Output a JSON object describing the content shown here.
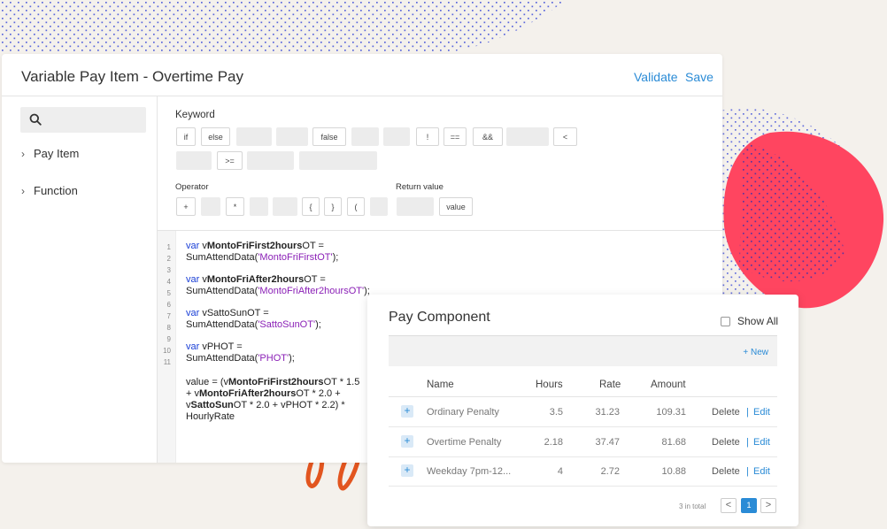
{
  "editor": {
    "title": "Variable Pay Item - Overtime Pay",
    "validate_label": "Validate",
    "save_label": "Save"
  },
  "sidebar": {
    "search_icon": "search-icon",
    "items": [
      {
        "label": "Pay Item",
        "icon": "chevron-right-icon"
      },
      {
        "label": "Function",
        "icon": "chevron-right-icon"
      }
    ]
  },
  "palette": {
    "keyword_label": "Keyword",
    "operator_label": "Operator",
    "return_value_label": "Return value",
    "keywords_row1": [
      "if",
      "else",
      "",
      "",
      "false",
      "",
      "",
      "!",
      "==",
      "&&",
      "",
      "<"
    ],
    "keywords_row2": [
      "",
      ">=",
      "",
      ""
    ],
    "operators": [
      "+",
      "",
      "*",
      "",
      "",
      "{",
      "}",
      "(",
      ""
    ],
    "return_values": [
      "",
      "value"
    ]
  },
  "code": {
    "line_numbers": [
      "1",
      "2",
      "3",
      "4",
      "5",
      "6",
      "7",
      "8",
      "9",
      "10",
      "11"
    ]
  },
  "pay_component": {
    "title": "Pay Component",
    "show_all_label": "Show All",
    "new_label": "+ New",
    "columns": [
      "Name",
      "Hours",
      "Rate",
      "Amount"
    ],
    "rows": [
      {
        "name": "Ordinary Penalty",
        "hours": "3.5",
        "rate": "31.23",
        "amount": "109.31"
      },
      {
        "name": "Overtime Penalty",
        "hours": "2.18",
        "rate": "37.47",
        "amount": "81.68"
      },
      {
        "name": "Weekday 7pm-12...",
        "hours": "4",
        "rate": "2.72",
        "amount": "10.88"
      }
    ],
    "delete_label": "Delete",
    "separator": "|",
    "edit_label": "Edit",
    "pager": {
      "total_text": "3 in total",
      "prev": "<",
      "current": "1",
      "next": ">"
    }
  },
  "colors": {
    "accent": "#2a8bd6",
    "coral": "#ff4560",
    "dots": "#3f4fd8",
    "squiggle": "#e2551f"
  }
}
